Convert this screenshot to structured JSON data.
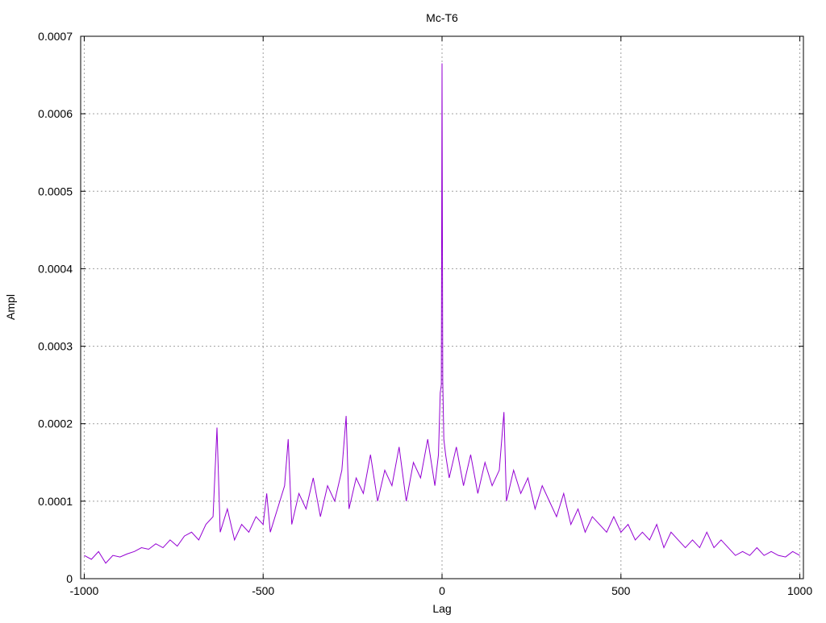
{
  "chart_data": {
    "type": "line",
    "title": "Mc-T6",
    "xlabel": "Lag",
    "ylabel": "Ampl",
    "xlim": [
      -1010,
      1010
    ],
    "ylim": [
      0,
      0.0007
    ],
    "grid": true,
    "legend": "none",
    "x_ticks": [
      {
        "value": -1000,
        "label": "-1000"
      },
      {
        "value": -500,
        "label": "-500"
      },
      {
        "value": 0,
        "label": "0"
      },
      {
        "value": 500,
        "label": "500"
      },
      {
        "value": 1000,
        "label": "1000"
      }
    ],
    "y_ticks": [
      {
        "value": 0,
        "label": "0"
      },
      {
        "value": 0.0001,
        "label": "0.0001"
      },
      {
        "value": 0.0002,
        "label": "0.0002"
      },
      {
        "value": 0.0003,
        "label": "0.0003"
      },
      {
        "value": 0.0004,
        "label": "0.0004"
      },
      {
        "value": 0.0005,
        "label": "0.0005"
      },
      {
        "value": 0.0006,
        "label": "0.0006"
      },
      {
        "value": 0.0007,
        "label": "0.0007"
      }
    ],
    "series": [
      {
        "color": "#9400d3",
        "x": [
          -1000,
          -980,
          -960,
          -940,
          -920,
          -900,
          -880,
          -860,
          -840,
          -820,
          -800,
          -780,
          -760,
          -740,
          -720,
          -700,
          -680,
          -660,
          -640,
          -629,
          -620,
          -600,
          -580,
          -560,
          -540,
          -520,
          -500,
          -490,
          -480,
          -460,
          -440,
          -430,
          -420,
          -400,
          -380,
          -360,
          -340,
          -320,
          -300,
          -280,
          -268,
          -260,
          -240,
          -220,
          -200,
          -180,
          -160,
          -140,
          -120,
          -100,
          -80,
          -60,
          -40,
          -20,
          -10,
          -5,
          -2,
          0,
          2,
          5,
          10,
          20,
          40,
          60,
          80,
          100,
          120,
          140,
          160,
          173,
          180,
          200,
          220,
          240,
          260,
          280,
          300,
          320,
          340,
          360,
          380,
          400,
          420,
          440,
          460,
          480,
          500,
          520,
          540,
          560,
          580,
          600,
          620,
          640,
          660,
          680,
          700,
          720,
          740,
          760,
          780,
          800,
          820,
          840,
          860,
          880,
          900,
          920,
          940,
          960,
          980,
          1000
        ],
        "y": [
          3e-05,
          2.5e-05,
          3.5e-05,
          2e-05,
          3e-05,
          2.8e-05,
          3.2e-05,
          3.5e-05,
          4e-05,
          3.8e-05,
          4.5e-05,
          4e-05,
          5e-05,
          4.2e-05,
          5.5e-05,
          6e-05,
          5e-05,
          7e-05,
          8e-05,
          0.000195,
          6e-05,
          9e-05,
          5e-05,
          7e-05,
          6e-05,
          8e-05,
          7e-05,
          0.00011,
          6e-05,
          9e-05,
          0.00012,
          0.00018,
          7e-05,
          0.00011,
          9e-05,
          0.00013,
          8e-05,
          0.00012,
          0.0001,
          0.00014,
          0.00021,
          9e-05,
          0.00013,
          0.00011,
          0.00016,
          0.0001,
          0.00014,
          0.00012,
          0.00017,
          0.0001,
          0.00015,
          0.00013,
          0.00018,
          0.00012,
          0.00016,
          0.00024,
          0.00025,
          0.000665,
          0.000255,
          0.00018,
          0.00016,
          0.00013,
          0.00017,
          0.00012,
          0.00016,
          0.00011,
          0.00015,
          0.00012,
          0.00014,
          0.000215,
          0.0001,
          0.00014,
          0.00011,
          0.00013,
          9e-05,
          0.00012,
          0.0001,
          8e-05,
          0.00011,
          7e-05,
          9e-05,
          6e-05,
          8e-05,
          7e-05,
          6e-05,
          8e-05,
          6e-05,
          7e-05,
          5e-05,
          6e-05,
          5e-05,
          7e-05,
          4e-05,
          6e-05,
          5e-05,
          4e-05,
          5e-05,
          4e-05,
          6e-05,
          4e-05,
          5e-05,
          4e-05,
          3e-05,
          3.5e-05,
          3e-05,
          4e-05,
          3e-05,
          3.5e-05,
          3e-05,
          2.8e-05,
          3.5e-05,
          3e-05
        ]
      }
    ]
  }
}
